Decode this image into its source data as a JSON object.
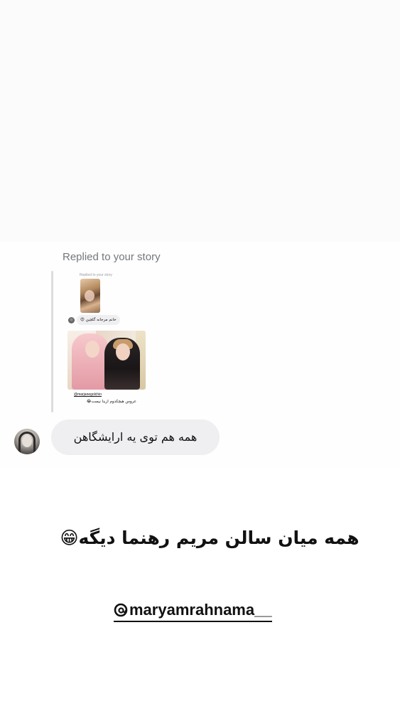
{
  "dm": {
    "replied_label": "Replied to your story",
    "nested_reply": {
      "replied_label": "Replied to your story",
      "bubble_text": "خانم مرجانه گلچین 😍",
      "handle": "@marjanegolchin",
      "caption": "عروس هیچکدوم ازینا نیست😂"
    },
    "message_text": "همه هم توی یه ارایشگاهن"
  },
  "story": {
    "caption": "همه میان سالن مریم رهنما دیگه😁",
    "mention": "maryamrahnama__"
  }
}
